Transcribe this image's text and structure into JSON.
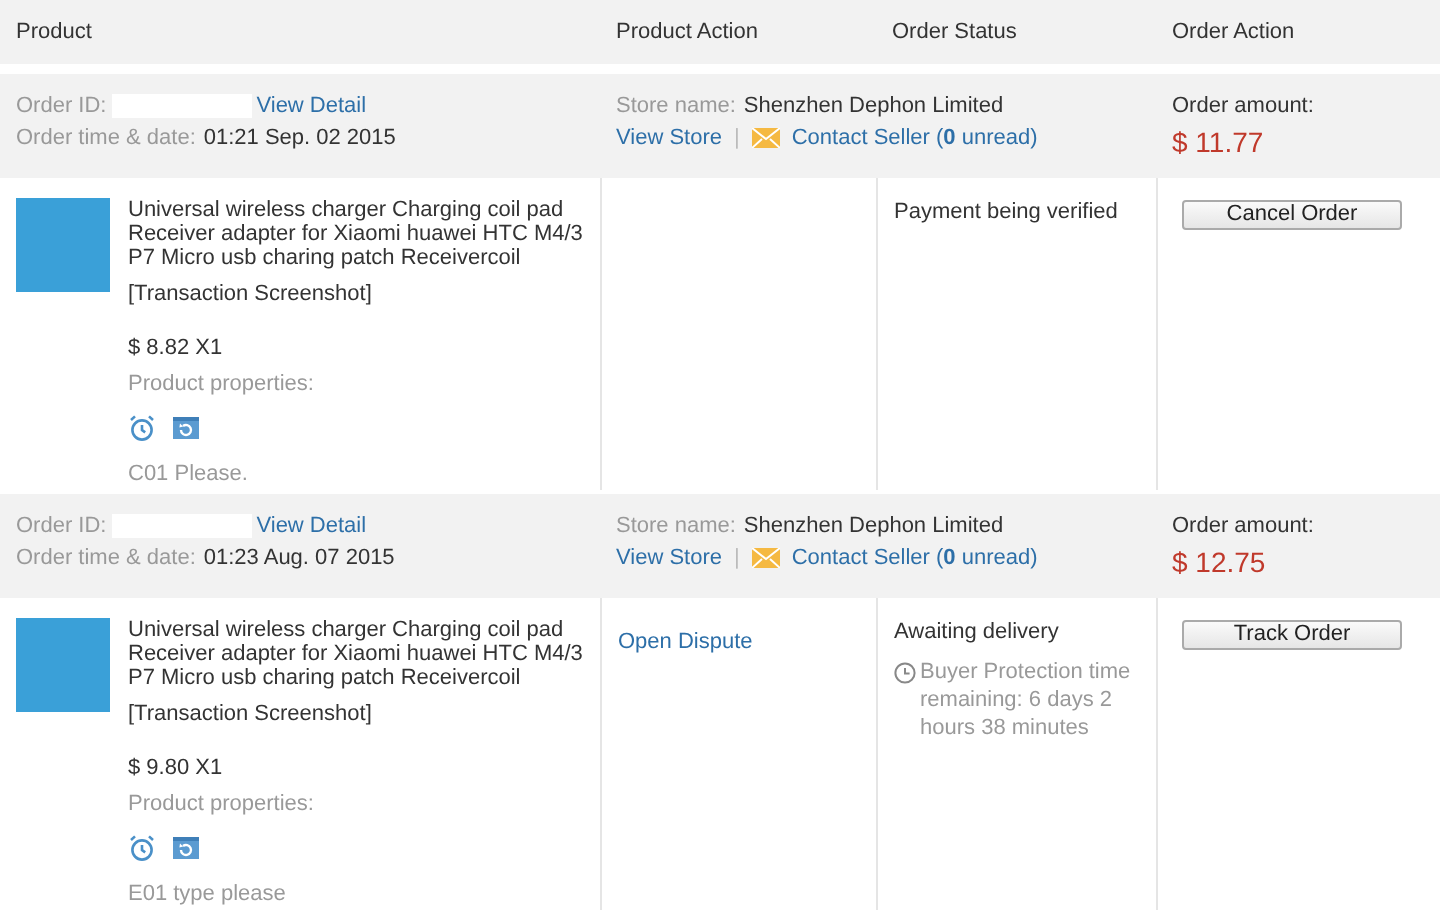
{
  "columns": [
    "Product",
    "Product Action",
    "Order Status",
    "Order Action"
  ],
  "orders": [
    {
      "order_id_label": "Order ID:",
      "view_detail": "View Detail",
      "time_label": "Order time & date:",
      "time": "01:21 Sep. 02 2015",
      "store_label": "Store name:",
      "store": "Shenzhen Dephon Limited",
      "view_store": "View Store",
      "separator": "|",
      "contact_seller": "Contact Seller (**0** unread)",
      "amount_label": "Order amount:",
      "amount": "$ 11.77",
      "product": {
        "title": "Universal wireless charger Charging coil pad Receiver adapter for Xiaomi huawei HTC M4/3 P7 Micro usb charing patch Receivercoil",
        "transaction": "[Transaction Screenshot]",
        "price": "$ 8.82 X1",
        "properties_label": "Product properties:",
        "note": "C01 Please."
      },
      "status": "Payment being verified",
      "action_button": "Cancel Order"
    },
    {
      "order_id_label": "Order ID:",
      "view_detail": "View Detail",
      "time_label": "Order time & date:",
      "time": "01:23 Aug. 07 2015",
      "store_label": "Store name:",
      "store": "Shenzhen Dephon Limited",
      "view_store": "View Store",
      "separator": "|",
      "contact_seller": "Contact Seller (**0** unread)",
      "amount_label": "Order amount:",
      "amount": "$ 12.75",
      "product": {
        "title": "Universal wireless charger Charging coil pad Receiver adapter for Xiaomi huawei HTC M4/3 P7 Micro usb charing patch Receivercoil",
        "transaction": "[Transaction Screenshot]",
        "price": "$ 9.80 X1",
        "properties_label": "Product properties:",
        "note": "E01 type please"
      },
      "product_action": "Open Dispute",
      "status": "Awaiting delivery",
      "protection": "Buyer Protection time remaining: 6 days 2 hours 38 minutes",
      "action_button": "Track Order"
    }
  ]
}
